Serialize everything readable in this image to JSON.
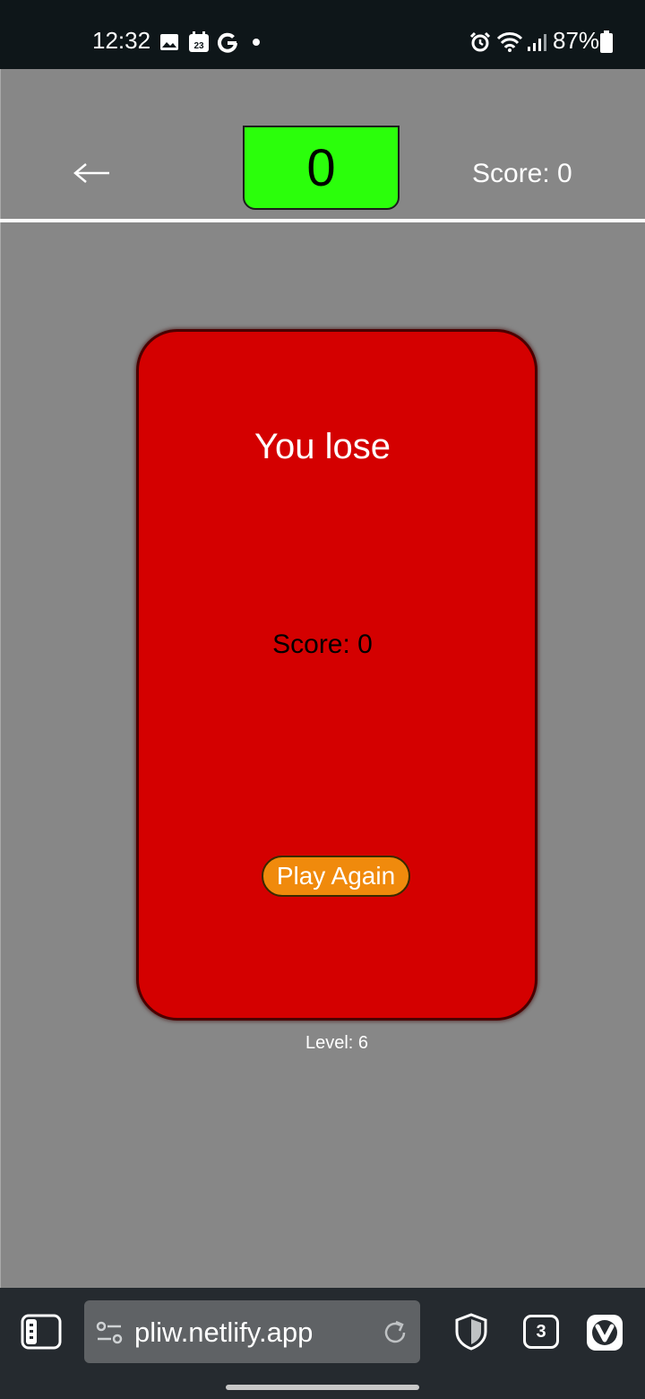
{
  "status_bar": {
    "time": "12:32",
    "battery": "87%",
    "calendar_day": "23",
    "icons": [
      "gallery-icon",
      "calendar-icon",
      "google-icon",
      "notification-dot-icon",
      "alarm-icon",
      "wifi-icon",
      "signal-icon",
      "battery-icon"
    ]
  },
  "game_header": {
    "counter": "0",
    "score": "Score: 0",
    "counter_color": "#2bff0b"
  },
  "card": {
    "title": "You lose",
    "score": "Score: 0",
    "button_label": "Play Again",
    "card_color": "#d40000",
    "button_color": "#f08a0c"
  },
  "level": "Level: 6",
  "browser": {
    "url": "pliw.netlify.app",
    "tab_count": "3",
    "icons": [
      "panels-icon",
      "site-settings-icon",
      "reload-icon",
      "shield-icon",
      "tabs-icon",
      "vivaldi-menu-icon"
    ]
  },
  "colors": {
    "page_background": "#878787",
    "status_bar": "#0e1619",
    "browser_bar": "#252a2f"
  }
}
